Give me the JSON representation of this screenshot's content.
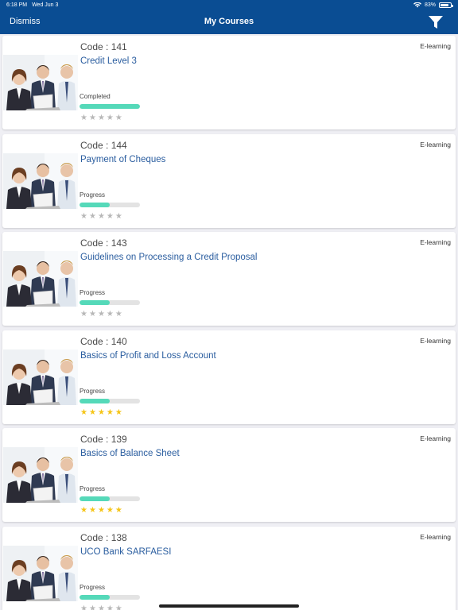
{
  "status_bar": {
    "time": "6:18 PM",
    "date": "Wed Jun 3",
    "battery": "83%",
    "battery_level": 0.83
  },
  "navbar": {
    "dismiss_label": "Dismiss",
    "title": "My Courses",
    "filter_icon": "filter-funnel-icon"
  },
  "colors": {
    "nav_background": "#0a4d93",
    "progress_fill": "#55d9b9",
    "progress_track": "#e3e3e3",
    "star_filled": "#f5c518",
    "star_empty": "#b8b8b8",
    "title_text": "#2a5d9f"
  },
  "courses": [
    {
      "code": "Code : 141",
      "title": "Credit Level 3",
      "type": "E-learning",
      "status": "Completed",
      "progress": 1.0,
      "rating": 0,
      "max_rating": 5
    },
    {
      "code": "Code : 144",
      "title": "Payment of Cheques",
      "type": "E-learning",
      "status": "Progress",
      "progress": 0.5,
      "rating": 0,
      "max_rating": 5
    },
    {
      "code": "Code : 143",
      "title": "Guidelines on Processing a Credit Proposal",
      "type": "E-learning",
      "status": "Progress",
      "progress": 0.5,
      "rating": 0,
      "max_rating": 5
    },
    {
      "code": "Code : 140",
      "title": "Basics of Profit and Loss Account",
      "type": "E-learning",
      "status": "Progress",
      "progress": 0.5,
      "rating": 5,
      "max_rating": 5
    },
    {
      "code": "Code : 139",
      "title": "Basics of Balance Sheet",
      "type": "E-learning",
      "status": "Progress",
      "progress": 0.5,
      "rating": 5,
      "max_rating": 5
    },
    {
      "code": "Code : 138",
      "title": "UCO Bank SARFAESI",
      "type": "E-learning",
      "status": "Progress",
      "progress": 0.5,
      "rating": 0,
      "max_rating": 5
    }
  ]
}
